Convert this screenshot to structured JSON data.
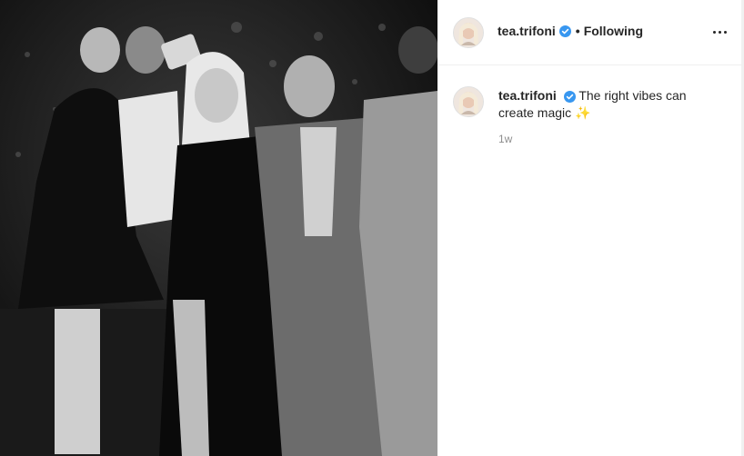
{
  "post": {
    "image_alt": "Black and white photo of people posing for a selfie on a stage",
    "username": "tea.trifoni",
    "follow_status": "Following",
    "dot": "•",
    "caption_text": "The right vibes can create magic",
    "caption_emoji": "✨",
    "timestamp": "1w"
  },
  "colors": {
    "verified": "#3897f0",
    "timestamp": "#8e8e8e"
  }
}
